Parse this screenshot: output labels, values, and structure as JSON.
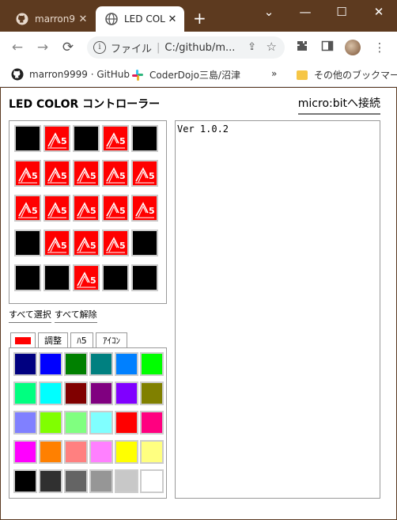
{
  "browser": {
    "tabs": [
      {
        "title": "marron9",
        "close": "✕"
      },
      {
        "title": "LED COL",
        "close": "✕"
      }
    ],
    "new_tab": "+",
    "window_controls": [
      "⌄",
      "—",
      "☐",
      "✕"
    ],
    "address": {
      "label": "ファイル",
      "url": "C:/github/m..."
    },
    "bookmarks": [
      {
        "label": "marron9999 · GitHub"
      },
      {
        "label": "CoderDojo三島/沼津"
      },
      {
        "label": "»"
      },
      {
        "label": "その他のブックマーク"
      }
    ]
  },
  "app": {
    "title": "LED COLOR コントローラー",
    "connect_label": "micro:bitへ接続",
    "select_all": "すべて選択",
    "deselect_all": "すべて解除",
    "tabs": [
      {
        "label": "",
        "swatch": "#ff0000"
      },
      {
        "label": "調整"
      },
      {
        "label": "ﾊ5"
      },
      {
        "label": "ｱｲｺﾝ"
      }
    ],
    "console_text": "Ver 1.0.2",
    "led_icon_text": "5",
    "led_matrix": [
      [
        "#000000",
        "#ff0000",
        "#000000",
        "#ff0000",
        "#000000"
      ],
      [
        "#ff0000",
        "#ff0000",
        "#ff0000",
        "#ff0000",
        "#ff0000"
      ],
      [
        "#ff0000",
        "#ff0000",
        "#ff0000",
        "#ff0000",
        "#ff0000"
      ],
      [
        "#000000",
        "#ff0000",
        "#ff0000",
        "#ff0000",
        "#000000"
      ],
      [
        "#000000",
        "#000000",
        "#ff0000",
        "#000000",
        "#000000"
      ]
    ],
    "palette": [
      [
        "#000080",
        "#0000ff",
        "#008000",
        "#008080",
        "#0080ff",
        "#00ff00"
      ],
      [
        "#00ff80",
        "#00ffff",
        "#800000",
        "#800080",
        "#8000ff",
        "#808000"
      ],
      [
        "#8080ff",
        "#80ff00",
        "#80ff80",
        "#80ffff",
        "#ff0000",
        "#ff0080"
      ],
      [
        "#ff00ff",
        "#ff8000",
        "#ff8080",
        "#ff80ff",
        "#ffff00",
        "#ffff80"
      ],
      [
        "#000000",
        "#303030",
        "#646464",
        "#969696",
        "#c8c8c8",
        "#ffffff"
      ]
    ]
  }
}
